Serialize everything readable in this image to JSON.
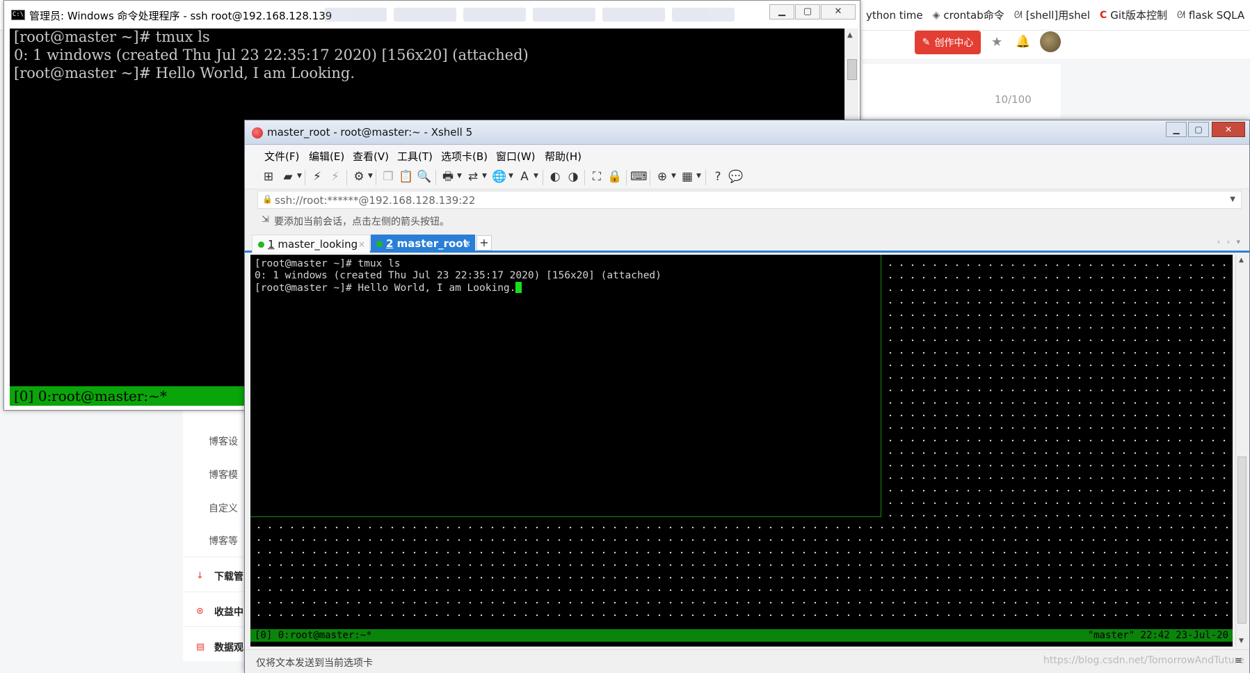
{
  "browser": {
    "bookmarks": [
      {
        "icon": "doc-icon",
        "label": "ython time"
      },
      {
        "icon": "diamond-icon",
        "label": "crontab命令"
      },
      {
        "icon": "bird-icon",
        "label": "[shell]用shel"
      },
      {
        "icon": "csdn-c-icon",
        "label": "Git版本控制"
      },
      {
        "icon": "bird-icon",
        "label": "flask SQLA"
      }
    ],
    "create_button": "创作中心",
    "word_count": "10/100",
    "sidebar_items": [
      "博客设",
      "博客模",
      "自定义",
      "博客等"
    ],
    "sidebar_bold_items": [
      "下载管",
      "收益中",
      "数据观"
    ],
    "watermark": "https://blog.csdn.net/TomorrowAndTuture"
  },
  "cmd": {
    "title": "管理员: Windows 命令处理程序 - ssh  root@192.168.128.139",
    "lines": [
      "[root@master ~]# tmux ls",
      "0: 1 windows (created Thu Jul 23 22:35:17 2020) [156x20] (attached)",
      "[root@master ~]# Hello World, I am Looking."
    ],
    "status": "[0] 0:root@master:~*"
  },
  "xshell": {
    "title": "master_root - root@master:~ - Xshell 5",
    "menu": [
      "文件(F)",
      "编辑(E)",
      "查看(V)",
      "工具(T)",
      "选项卡(B)",
      "窗口(W)",
      "帮助(H)"
    ],
    "address": "ssh://root:******@192.168.128.139:22",
    "hint": "要添加当前会话，点击左侧的箭头按钮。",
    "tabs": [
      {
        "num": "1",
        "label": "master_looking"
      },
      {
        "num": "2",
        "label": "master_root"
      }
    ],
    "terminal_lines": [
      "[root@master ~]# tmux ls",
      "0: 1 windows (created Thu Jul 23 22:35:17 2020) [156x20] (attached)",
      "[root@master ~]# Hello World, I am Looking."
    ],
    "tmux_status_left": "[0] 0:root@master:~*",
    "tmux_status_right": "\"master\" 22:42 23-Jul-20",
    "statusbar": "仅将文本发送到当前选项卡"
  }
}
